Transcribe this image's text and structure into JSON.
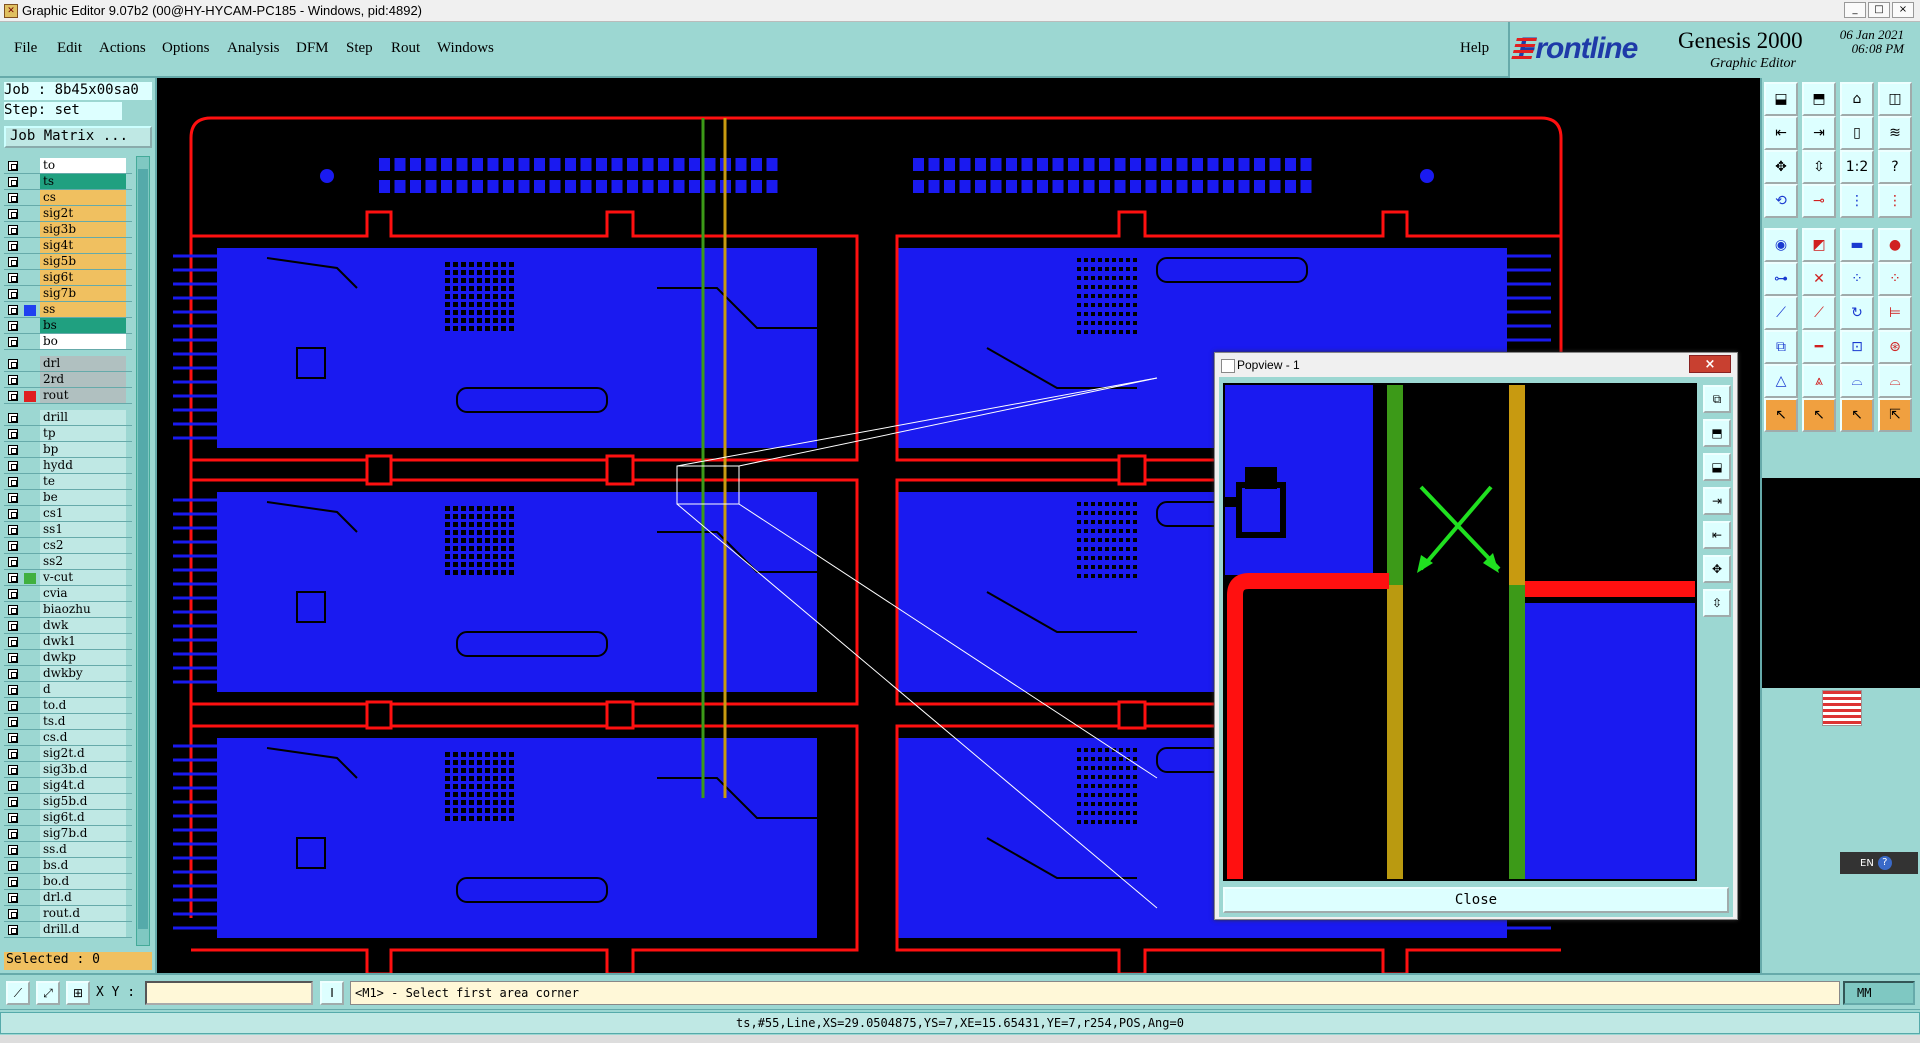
{
  "window": {
    "title": "Graphic Editor 9.07b2 (00@HY-HYCAM-PC185 - Windows, pid:4892)",
    "controls": [
      "_",
      "□",
      "×"
    ]
  },
  "menu": {
    "items": [
      "File",
      "Edit",
      "Actions",
      "Options",
      "Analysis",
      "DFM",
      "Step",
      "Rout",
      "Windows"
    ],
    "help": "Help"
  },
  "brand": {
    "logo": "Frontline",
    "product": "Genesis 2000",
    "subtitle": "Graphic Editor",
    "date": "06 Jan 2021",
    "time": "06:08 PM"
  },
  "job": {
    "job_label": "Job : 8b45x00sa0",
    "step_label": "Step: set",
    "job_matrix": "Job Matrix ..."
  },
  "layers_group1": [
    {
      "name": "to",
      "bg": "#ffffff",
      "swatch": ""
    },
    {
      "name": "ts",
      "bg": "#20a080",
      "swatch": ""
    },
    {
      "name": "cs",
      "bg": "#f0c060",
      "swatch": ""
    },
    {
      "name": "sig2t",
      "bg": "#f0c060",
      "swatch": ""
    },
    {
      "name": "sig3b",
      "bg": "#f0c060",
      "swatch": ""
    },
    {
      "name": "sig4t",
      "bg": "#f0c060",
      "swatch": ""
    },
    {
      "name": "sig5b",
      "bg": "#f0c060",
      "swatch": ""
    },
    {
      "name": "sig6t",
      "bg": "#f0c060",
      "swatch": ""
    },
    {
      "name": "sig7b",
      "bg": "#f0c060",
      "swatch": ""
    },
    {
      "name": "ss",
      "bg": "#f0c060",
      "swatch": "#2040f0"
    },
    {
      "name": "bs",
      "bg": "#20a080",
      "swatch": ""
    },
    {
      "name": "bo",
      "bg": "#ffffff",
      "swatch": ""
    }
  ],
  "layers_group2": [
    {
      "name": "drl",
      "bg": "#b0c0c0",
      "swatch": ""
    },
    {
      "name": "2rd",
      "bg": "#b0c0c0",
      "swatch": ""
    },
    {
      "name": "rout",
      "bg": "#b0c0c0",
      "swatch": "#e02020"
    }
  ],
  "layers_group3": [
    {
      "name": "drill",
      "bg": "#bfe8e4",
      "swatch": ""
    },
    {
      "name": "tp",
      "bg": "#bfe8e4",
      "swatch": ""
    },
    {
      "name": "bp",
      "bg": "#bfe8e4",
      "swatch": ""
    },
    {
      "name": "hydd",
      "bg": "#bfe8e4",
      "swatch": ""
    },
    {
      "name": "te",
      "bg": "#bfe8e4",
      "swatch": ""
    },
    {
      "name": "be",
      "bg": "#bfe8e4",
      "swatch": ""
    },
    {
      "name": "cs1",
      "bg": "#bfe8e4",
      "swatch": ""
    },
    {
      "name": "ss1",
      "bg": "#bfe8e4",
      "swatch": ""
    },
    {
      "name": "cs2",
      "bg": "#bfe8e4",
      "swatch": ""
    },
    {
      "name": "ss2",
      "bg": "#bfe8e4",
      "swatch": ""
    },
    {
      "name": "v-cut",
      "bg": "#bfe8e4",
      "swatch": "#40b040"
    },
    {
      "name": "cvia",
      "bg": "#bfe8e4",
      "swatch": ""
    },
    {
      "name": "biaozhu",
      "bg": "#bfe8e4",
      "swatch": ""
    },
    {
      "name": "dwk",
      "bg": "#bfe8e4",
      "swatch": ""
    },
    {
      "name": "dwk1",
      "bg": "#bfe8e4",
      "swatch": ""
    },
    {
      "name": "dwkp",
      "bg": "#bfe8e4",
      "swatch": ""
    },
    {
      "name": "dwkby",
      "bg": "#bfe8e4",
      "swatch": ""
    },
    {
      "name": "d",
      "bg": "#bfe8e4",
      "swatch": ""
    },
    {
      "name": "to.d",
      "bg": "#bfe8e4",
      "swatch": ""
    },
    {
      "name": "ts.d",
      "bg": "#bfe8e4",
      "swatch": ""
    },
    {
      "name": "cs.d",
      "bg": "#bfe8e4",
      "swatch": ""
    },
    {
      "name": "sig2t.d",
      "bg": "#bfe8e4",
      "swatch": ""
    },
    {
      "name": "sig3b.d",
      "bg": "#bfe8e4",
      "swatch": ""
    },
    {
      "name": "sig4t.d",
      "bg": "#bfe8e4",
      "swatch": ""
    },
    {
      "name": "sig5b.d",
      "bg": "#bfe8e4",
      "swatch": ""
    },
    {
      "name": "sig6t.d",
      "bg": "#bfe8e4",
      "swatch": ""
    },
    {
      "name": "sig7b.d",
      "bg": "#bfe8e4",
      "swatch": ""
    },
    {
      "name": "ss.d",
      "bg": "#bfe8e4",
      "swatch": ""
    },
    {
      "name": "bs.d",
      "bg": "#bfe8e4",
      "swatch": ""
    },
    {
      "name": "bo.d",
      "bg": "#bfe8e4",
      "swatch": ""
    },
    {
      "name": "drl.d",
      "bg": "#bfe8e4",
      "swatch": ""
    },
    {
      "name": "rout.d",
      "bg": "#bfe8e4",
      "swatch": ""
    },
    {
      "name": "drill.d",
      "bg": "#bfe8e4",
      "swatch": ""
    }
  ],
  "selected": "Selected : 0",
  "popview": {
    "title": "Popview - 1",
    "close_x": "×",
    "close_btn": "Close"
  },
  "bottom": {
    "xy_label": "X Y :",
    "xy_value": "",
    "message": "<M1> - Select first area corner",
    "units": "MM"
  },
  "status": "ts,#55,Line,XS=29.0504875,YS=7,XE=15.65431,YE=7,r254,POS,Ang=0",
  "tray": {
    "lang": "EN",
    "help": "?"
  },
  "colors": {
    "panel": "#9cd7d2",
    "copper": "#1a1af0",
    "rout": "#ff1010",
    "vcut_green": "#3c9a18",
    "vcut_orange": "#c89a10"
  }
}
